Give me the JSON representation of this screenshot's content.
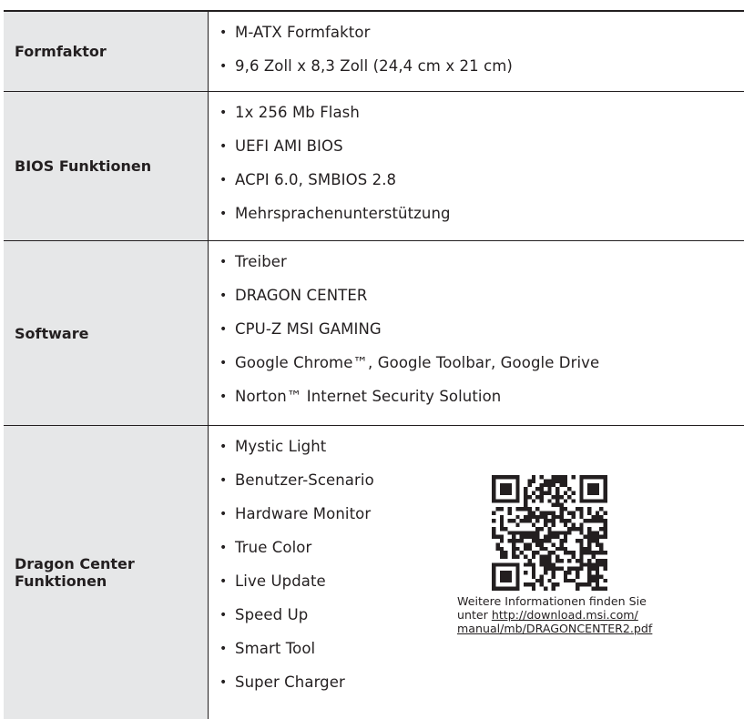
{
  "rows": [
    {
      "label": "Formfaktor",
      "items": [
        "M-ATX Formfaktor",
        "9,6 Zoll x 8,3 Zoll (24,4 cm x 21 cm)"
      ]
    },
    {
      "label": "BIOS Funktionen",
      "items": [
        "1x 256 Mb Flash",
        "UEFI AMI BIOS",
        "ACPI 6.0, SMBIOS 2.8",
        "Mehrsprachenunterstützung"
      ]
    },
    {
      "label": "Software",
      "items": [
        "Treiber",
        "DRAGON CENTER",
        "CPU-Z MSI GAMING",
        "Google Chrome™, Google Toolbar, Google Drive",
        "Norton™ Internet Security Solution"
      ]
    },
    {
      "label": "Dragon Center Funktionen",
      "items": [
        "Mystic Light",
        "Benutzer-Scenario",
        "Hardware Monitor",
        "True Color",
        "Live Update",
        "Speed Up",
        "Smart Tool",
        "Super Charger"
      ]
    }
  ],
  "qr": {
    "caption_line1": "Weitere Informationen finden Sie",
    "caption_prefix": "unter ",
    "link_part1": "http://download.msi.com/",
    "link_part2": "manual/mb/DRAGONCENTER2.pdf"
  },
  "colors": {
    "label_background": "#e6e7e8",
    "rule": "#231f20",
    "text": "#231f20"
  }
}
